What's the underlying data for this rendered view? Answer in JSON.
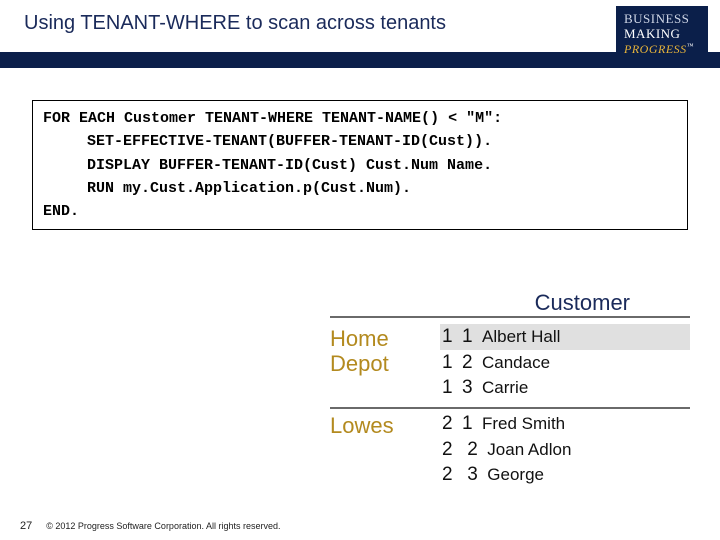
{
  "header": {
    "title": "Using TENANT-WHERE to scan across tenants"
  },
  "logo": {
    "line1": "BUSINESS",
    "line2": "MAKING",
    "line3": "PROGRESS",
    "tm": "™"
  },
  "code": {
    "line1": "FOR EACH Customer TENANT-WHERE TENANT-NAME() < \"M\":",
    "line2": "SET-EFFECTIVE-TENANT(BUFFER-TENANT-ID(Cust)).",
    "line3": "DISPLAY BUFFER-TENANT-ID(Cust) Cust.Num Name.",
    "line4": "RUN my.Cust.Application.p(Cust.Num).",
    "line5": "END."
  },
  "table": {
    "heading": "Customer",
    "tenants": [
      {
        "name": "Home Depot",
        "rows": [
          {
            "tid": "1",
            "num": "1",
            "name": "Albert Hall"
          },
          {
            "tid": "1",
            "num": "2",
            "name": "Candace"
          },
          {
            "tid": "1",
            "num": "3",
            "name": "Carrie"
          }
        ]
      },
      {
        "name": "Lowes",
        "rows": [
          {
            "tid": "2",
            "num": "1",
            "name": "Fred Smith"
          },
          {
            "tid": "2",
            "num": "2",
            "name": "Joan Adlon"
          },
          {
            "tid": "2",
            "num": "3",
            "name": "George"
          }
        ]
      }
    ]
  },
  "footer": {
    "page": "27",
    "copyright": "© 2012 Progress Software Corporation. All rights reserved."
  }
}
